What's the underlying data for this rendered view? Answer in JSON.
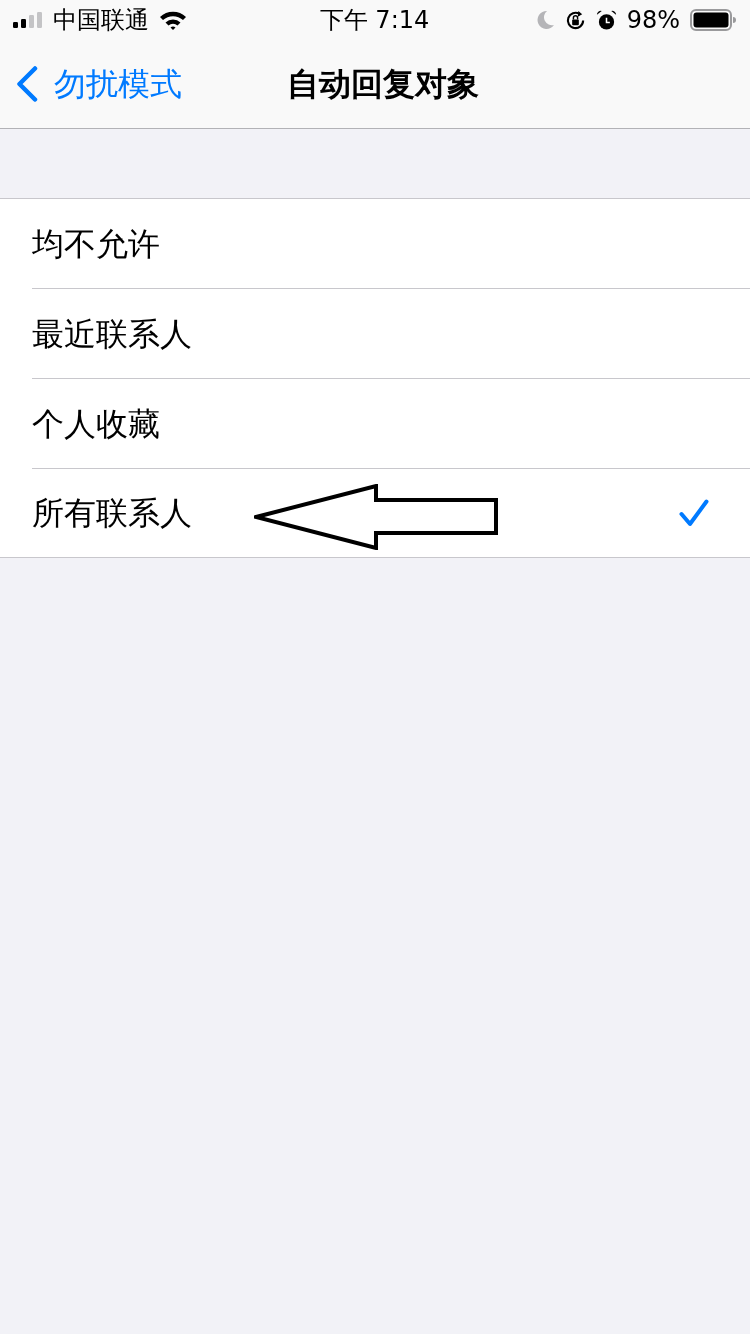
{
  "status_bar": {
    "carrier": "中国联通",
    "time": "下午 7:14",
    "battery": "98%"
  },
  "nav_bar": {
    "back": "勿扰模式",
    "title": "自动回复对象"
  },
  "options": [
    {
      "label": "均不允许",
      "selected": false,
      "annotated": false
    },
    {
      "label": "最近联系人",
      "selected": false,
      "annotated": false
    },
    {
      "label": "个人收藏",
      "selected": false,
      "annotated": false
    },
    {
      "label": "所有联系人",
      "selected": true,
      "annotated": true
    }
  ]
}
